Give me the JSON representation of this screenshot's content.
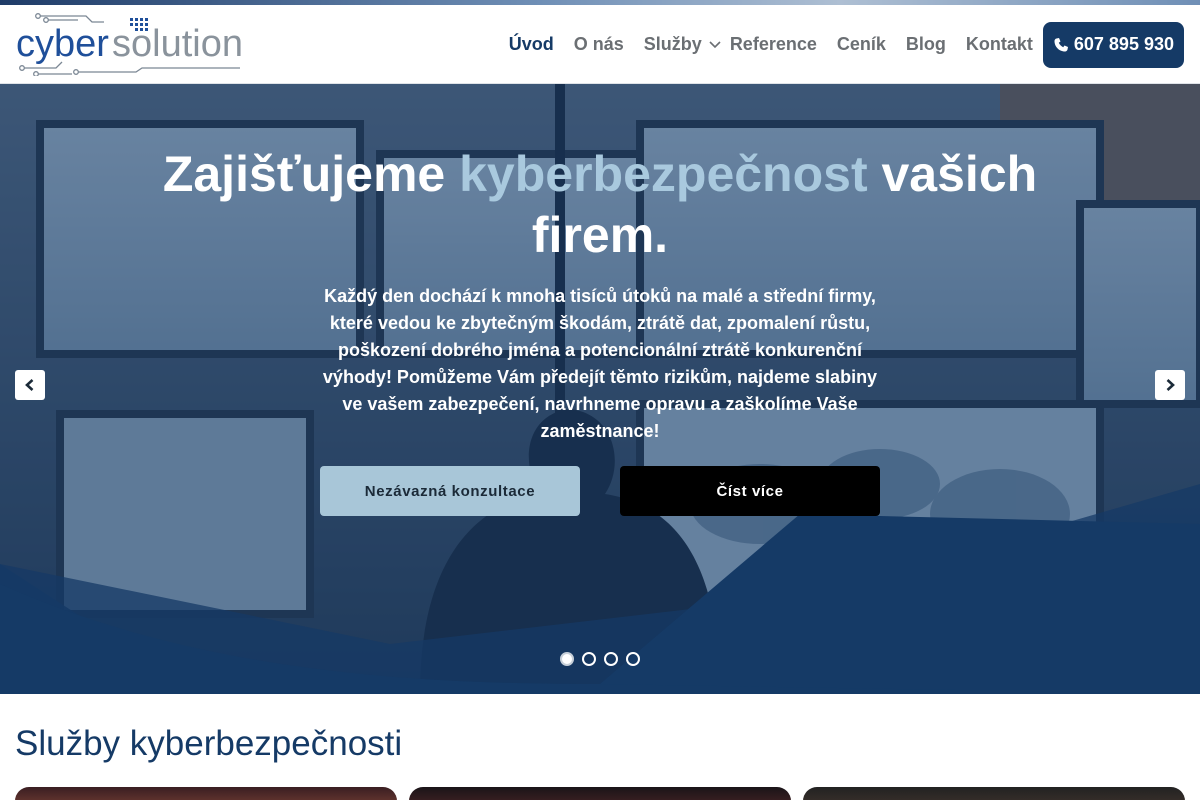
{
  "brand": {
    "logo_text_prefix": "cyber",
    "logo_text_suffix": "solution"
  },
  "nav": {
    "items": [
      {
        "label": "Úvod",
        "active": true
      },
      {
        "label": "O nás",
        "active": false
      },
      {
        "label": "Služby",
        "active": false,
        "has_dropdown": true
      },
      {
        "label": "Reference",
        "active": false
      },
      {
        "label": "Ceník",
        "active": false
      },
      {
        "label": "Blog",
        "active": false
      },
      {
        "label": "Kontakt",
        "active": false
      }
    ],
    "phone": "607 895 930",
    "phone_icon": "phone-icon"
  },
  "hero": {
    "title_part1": "Zajišťujeme ",
    "title_highlight": "kyberbezpečnost",
    "title_part2": " vašich firem.",
    "text": "Každý den dochází k mnoha tisíců útoků na malé a střední firmy, které vedou ke zbytečným škodám, ztrátě dat, zpomalení růstu, poškození dobrého jména a potencionální ztrátě konkurenční výhody! Pomůžeme Vám předejít těmto rizikům, najdeme slabiny ve vašem zabezpečení, navrhneme opravu a zaškolíme Vaše zaměstnance!",
    "btn_consult": "Nezávazná konzultace",
    "btn_read": "Číst více",
    "slides_count": 4,
    "active_slide": 1
  },
  "services": {
    "title": "Služby kyberbezpečnosti"
  },
  "colors": {
    "primary": "#153a66",
    "accent_light": "#a8c6d8",
    "highlight": "#a9c9de",
    "nav_text": "#6b6f73"
  }
}
